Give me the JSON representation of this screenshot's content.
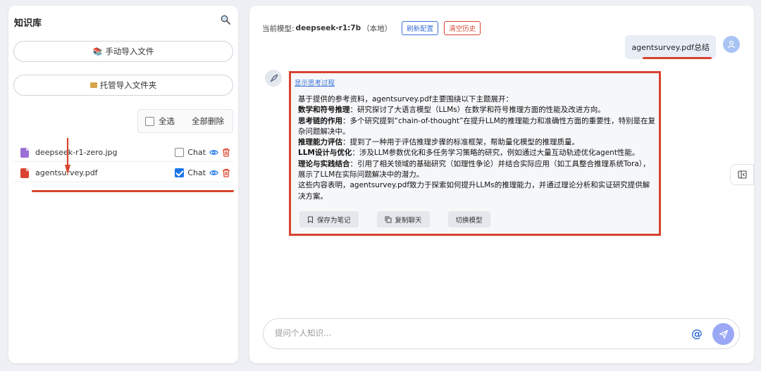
{
  "knowledge_base": {
    "title": "知识库",
    "import_files_label": "手动导入文件",
    "import_folder_label": "托管导入文件夹",
    "select_all_label": "全选",
    "delete_all_label": "全部删除",
    "files": [
      {
        "name": "deepseek-r1-zero.jpg",
        "chat_label": "Chat",
        "chat_checked": false,
        "type": "image"
      },
      {
        "name": "agentsurvey.pdf",
        "chat_label": "Chat",
        "chat_checked": true,
        "type": "pdf"
      }
    ]
  },
  "chat": {
    "model_prefix": "当前模型:",
    "model_name": "deepseek-r1:7b",
    "model_suffix": "（本地）",
    "refresh_config_label": "刷新配置",
    "clear_history_label": "清空历史",
    "user_message": "agentsurvey.pdf总结",
    "show_thinking_label": "显示思考过程",
    "answer": {
      "intro": "基于提供的参考资料，agentsurvey.pdf主要围绕以下主题展开：",
      "items": [
        {
          "title": "数学和符号推理",
          "text": "：研究探讨了大语言模型（LLMs）在数学和符号推理方面的性能及改进方向。"
        },
        {
          "title": "思考链的作用",
          "text": "：多个研究提到“chain-of-thought”在提升LLM的推理能力和准确性方面的重要性，特别是在复杂问题解决中。"
        },
        {
          "title": "推理能力评估",
          "text": "：提到了一种用于评估推理步骤的标准框架，帮助量化模型的推理质量。"
        },
        {
          "title": "LLM设计与优化",
          "text": "：涉及LLM参数优化和多任务学习策略的研究，例如通过大量互动轨迹优化agent性能。"
        },
        {
          "title": "理论与实践结合",
          "text": "：引用了相关领域的基础研究（如理性争论）并结合实际应用（如工具整合推理系统Tora），展示了LLM在实际问题解决中的潜力。"
        }
      ],
      "conclusion": "这些内容表明，agentsurvey.pdf致力于探索如何提升LLMs的推理能力，并通过理论分析和实证研究提供解决方案。"
    },
    "actions": {
      "save_note_label": "保存为笔记",
      "copy_chat_label": "复制聊天",
      "switch_model_label": "切换模型"
    },
    "input_placeholder": "提问个人知识...",
    "at_label": "@"
  },
  "colors": {
    "accent": "#1a73e8",
    "annotation_red": "#d9432f",
    "send_button": "#9aa8f5"
  }
}
